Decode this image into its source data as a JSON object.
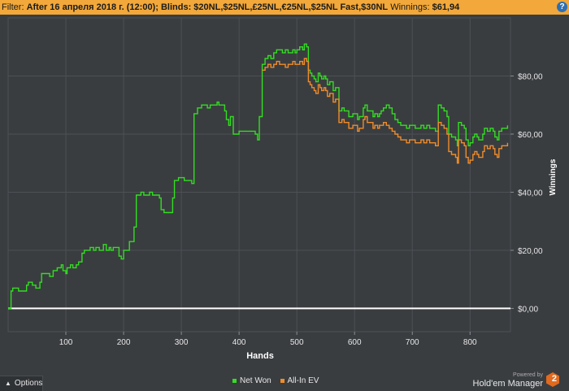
{
  "filter": {
    "prefix": "Filter:",
    "date": "After 16 апреля 2018 г. (12:00);",
    "blinds_label": "Blinds:",
    "blinds": "$20NL,$25NL,£25NL,€25NL,$25NL Fast,$30NL",
    "winnings_label": "Winnings:",
    "winnings": "$61,94"
  },
  "help_label": "?",
  "options_label": "Options",
  "brand": {
    "powered": "Powered by",
    "name": "Hold'em Manager",
    "version": "2"
  },
  "colors": {
    "net_won": "#33dd22",
    "all_in_ev": "#f08c2a",
    "zero_line": "#ffffff",
    "grid": "#4c5054",
    "background": "#3a3d40"
  },
  "chart_data": {
    "type": "line",
    "xlabel": "Hands",
    "ylabel": "Winnings",
    "xlim": [
      0,
      870
    ],
    "ylim": [
      -8,
      100
    ],
    "xticks": [
      100,
      200,
      300,
      400,
      500,
      600,
      700,
      800
    ],
    "xtick_labels": [
      "100",
      "200",
      "300",
      "400",
      "500",
      "600",
      "700",
      "800"
    ],
    "yticks": [
      0,
      20,
      40,
      60,
      80
    ],
    "ytick_labels": [
      "$0,00",
      "$20,00",
      "$40,00",
      "$60,00",
      "$80,00"
    ],
    "grid": true,
    "legend": "bottom-center",
    "series": [
      {
        "name": "Net Won",
        "points": [
          [
            0,
            0
          ],
          [
            3,
            0
          ],
          [
            5,
            6
          ],
          [
            8,
            7
          ],
          [
            15,
            7
          ],
          [
            18,
            6
          ],
          [
            25,
            6
          ],
          [
            32,
            8
          ],
          [
            35,
            9
          ],
          [
            42,
            8
          ],
          [
            48,
            7
          ],
          [
            55,
            9
          ],
          [
            58,
            12
          ],
          [
            65,
            12
          ],
          [
            72,
            11
          ],
          [
            78,
            13
          ],
          [
            85,
            14
          ],
          [
            92,
            15
          ],
          [
            95,
            13
          ],
          [
            100,
            12
          ],
          [
            102,
            14
          ],
          [
            108,
            15
          ],
          [
            112,
            14
          ],
          [
            118,
            15
          ],
          [
            122,
            16
          ],
          [
            128,
            19
          ],
          [
            132,
            20
          ],
          [
            138,
            20
          ],
          [
            142,
            21
          ],
          [
            148,
            20
          ],
          [
            152,
            21
          ],
          [
            158,
            20
          ],
          [
            165,
            22
          ],
          [
            170,
            20
          ],
          [
            175,
            21
          ],
          [
            178,
            20
          ],
          [
            182,
            21
          ],
          [
            188,
            21
          ],
          [
            192,
            18
          ],
          [
            196,
            17
          ],
          [
            200,
            20
          ],
          [
            205,
            20
          ],
          [
            210,
            23
          ],
          [
            218,
            28
          ],
          [
            222,
            39
          ],
          [
            230,
            40
          ],
          [
            235,
            39
          ],
          [
            240,
            39
          ],
          [
            245,
            40
          ],
          [
            250,
            39
          ],
          [
            258,
            39
          ],
          [
            262,
            38
          ],
          [
            265,
            34
          ],
          [
            270,
            33
          ],
          [
            275,
            33
          ],
          [
            278,
            33
          ],
          [
            282,
            33
          ],
          [
            285,
            38
          ],
          [
            288,
            44
          ],
          [
            295,
            45
          ],
          [
            300,
            45
          ],
          [
            305,
            44
          ],
          [
            312,
            44
          ],
          [
            318,
            43
          ],
          [
            322,
            67
          ],
          [
            328,
            69
          ],
          [
            335,
            70
          ],
          [
            340,
            70
          ],
          [
            345,
            69
          ],
          [
            350,
            70
          ],
          [
            358,
            70
          ],
          [
            362,
            71
          ],
          [
            365,
            70
          ],
          [
            370,
            70
          ],
          [
            375,
            68
          ],
          [
            378,
            65
          ],
          [
            382,
            63
          ],
          [
            385,
            66
          ],
          [
            390,
            60
          ],
          [
            395,
            60
          ],
          [
            400,
            61
          ],
          [
            405,
            61
          ],
          [
            410,
            61
          ],
          [
            420,
            61
          ],
          [
            428,
            60
          ],
          [
            432,
            58
          ],
          [
            435,
            66
          ],
          [
            440,
            84
          ],
          [
            445,
            86
          ],
          [
            450,
            87
          ],
          [
            455,
            86
          ],
          [
            460,
            88
          ],
          [
            465,
            89
          ],
          [
            470,
            89
          ],
          [
            475,
            88
          ],
          [
            480,
            89
          ],
          [
            485,
            88
          ],
          [
            490,
            88
          ],
          [
            493,
            89
          ],
          [
            497,
            88
          ],
          [
            500,
            89
          ],
          [
            505,
            90
          ],
          [
            510,
            89
          ],
          [
            513,
            91
          ],
          [
            517,
            90
          ],
          [
            520,
            82
          ],
          [
            523,
            81
          ],
          [
            526,
            80
          ],
          [
            530,
            79
          ],
          [
            533,
            78
          ],
          [
            537,
            81
          ],
          [
            540,
            80
          ],
          [
            543,
            79
          ],
          [
            547,
            80
          ],
          [
            550,
            79
          ],
          [
            553,
            77
          ],
          [
            557,
            78
          ],
          [
            560,
            78
          ],
          [
            563,
            75
          ],
          [
            567,
            76
          ],
          [
            570,
            76
          ],
          [
            573,
            68
          ],
          [
            578,
            69
          ],
          [
            582,
            68
          ],
          [
            585,
            68
          ],
          [
            590,
            66
          ],
          [
            593,
            66
          ],
          [
            597,
            67
          ],
          [
            600,
            67
          ],
          [
            605,
            65
          ],
          [
            608,
            66
          ],
          [
            612,
            66
          ],
          [
            615,
            69
          ],
          [
            618,
            70
          ],
          [
            622,
            68
          ],
          [
            625,
            68
          ],
          [
            628,
            68
          ],
          [
            632,
            66
          ],
          [
            635,
            67
          ],
          [
            640,
            66
          ],
          [
            643,
            67
          ],
          [
            646,
            68
          ],
          [
            650,
            69
          ],
          [
            655,
            70
          ],
          [
            660,
            69
          ],
          [
            665,
            67
          ],
          [
            670,
            65
          ],
          [
            675,
            64
          ],
          [
            680,
            63
          ],
          [
            685,
            63
          ],
          [
            690,
            62
          ],
          [
            695,
            63
          ],
          [
            700,
            63
          ],
          [
            705,
            62
          ],
          [
            710,
            62
          ],
          [
            715,
            63
          ],
          [
            720,
            62
          ],
          [
            725,
            63
          ],
          [
            730,
            62
          ],
          [
            735,
            62
          ],
          [
            740,
            61
          ],
          [
            745,
            70
          ],
          [
            750,
            69
          ],
          [
            755,
            68
          ],
          [
            760,
            66
          ],
          [
            763,
            60
          ],
          [
            768,
            59
          ],
          [
            772,
            59
          ],
          [
            775,
            58
          ],
          [
            778,
            56
          ],
          [
            780,
            64
          ],
          [
            785,
            63
          ],
          [
            790,
            62
          ],
          [
            793,
            58
          ],
          [
            797,
            56
          ],
          [
            800,
            57
          ],
          [
            805,
            59
          ],
          [
            808,
            60
          ],
          [
            812,
            59
          ],
          [
            815,
            58
          ],
          [
            818,
            58
          ],
          [
            822,
            60
          ],
          [
            825,
            62
          ],
          [
            830,
            61
          ],
          [
            835,
            62
          ],
          [
            840,
            61
          ],
          [
            843,
            59
          ],
          [
            847,
            58
          ],
          [
            850,
            61
          ],
          [
            855,
            62
          ],
          [
            860,
            62
          ],
          [
            865,
            63
          ]
        ]
      },
      {
        "name": "All-In EV",
        "points": [
          [
            440,
            82
          ],
          [
            445,
            83
          ],
          [
            450,
            84
          ],
          [
            455,
            83
          ],
          [
            460,
            84
          ],
          [
            465,
            85
          ],
          [
            470,
            84
          ],
          [
            475,
            84
          ],
          [
            480,
            83
          ],
          [
            485,
            84
          ],
          [
            490,
            84
          ],
          [
            493,
            85
          ],
          [
            497,
            84
          ],
          [
            500,
            84
          ],
          [
            505,
            85
          ],
          [
            510,
            84
          ],
          [
            513,
            86
          ],
          [
            517,
            85
          ],
          [
            520,
            78
          ],
          [
            523,
            77
          ],
          [
            526,
            76
          ],
          [
            530,
            75
          ],
          [
            533,
            74
          ],
          [
            537,
            77
          ],
          [
            540,
            76
          ],
          [
            543,
            75
          ],
          [
            547,
            76
          ],
          [
            550,
            75
          ],
          [
            553,
            73
          ],
          [
            557,
            74
          ],
          [
            560,
            74
          ],
          [
            563,
            71
          ],
          [
            567,
            72
          ],
          [
            570,
            72
          ],
          [
            573,
            64
          ],
          [
            578,
            65
          ],
          [
            582,
            64
          ],
          [
            585,
            64
          ],
          [
            590,
            62
          ],
          [
            593,
            62
          ],
          [
            597,
            63
          ],
          [
            600,
            63
          ],
          [
            605,
            61
          ],
          [
            608,
            62
          ],
          [
            612,
            62
          ],
          [
            615,
            65
          ],
          [
            618,
            66
          ],
          [
            622,
            64
          ],
          [
            625,
            64
          ],
          [
            628,
            64
          ],
          [
            632,
            62
          ],
          [
            635,
            63
          ],
          [
            640,
            62
          ],
          [
            643,
            63
          ],
          [
            646,
            63
          ],
          [
            650,
            64
          ],
          [
            655,
            63
          ],
          [
            660,
            62
          ],
          [
            665,
            61
          ],
          [
            670,
            60
          ],
          [
            675,
            59
          ],
          [
            680,
            58
          ],
          [
            685,
            58
          ],
          [
            690,
            57
          ],
          [
            695,
            58
          ],
          [
            700,
            58
          ],
          [
            705,
            57
          ],
          [
            710,
            57
          ],
          [
            715,
            58
          ],
          [
            720,
            57
          ],
          [
            725,
            58
          ],
          [
            730,
            57
          ],
          [
            735,
            57
          ],
          [
            740,
            56
          ],
          [
            745,
            64
          ],
          [
            750,
            63
          ],
          [
            755,
            62
          ],
          [
            760,
            60
          ],
          [
            763,
            54
          ],
          [
            768,
            53
          ],
          [
            772,
            53
          ],
          [
            775,
            52
          ],
          [
            778,
            50
          ],
          [
            780,
            58
          ],
          [
            785,
            57
          ],
          [
            790,
            56
          ],
          [
            793,
            52
          ],
          [
            797,
            50
          ],
          [
            800,
            51
          ],
          [
            805,
            53
          ],
          [
            808,
            54
          ],
          [
            812,
            53
          ],
          [
            815,
            52
          ],
          [
            818,
            52
          ],
          [
            822,
            54
          ],
          [
            825,
            56
          ],
          [
            830,
            55
          ],
          [
            835,
            56
          ],
          [
            840,
            55
          ],
          [
            843,
            53
          ],
          [
            847,
            52
          ],
          [
            850,
            55
          ],
          [
            855,
            56
          ],
          [
            860,
            56
          ],
          [
            865,
            57
          ]
        ]
      }
    ]
  }
}
